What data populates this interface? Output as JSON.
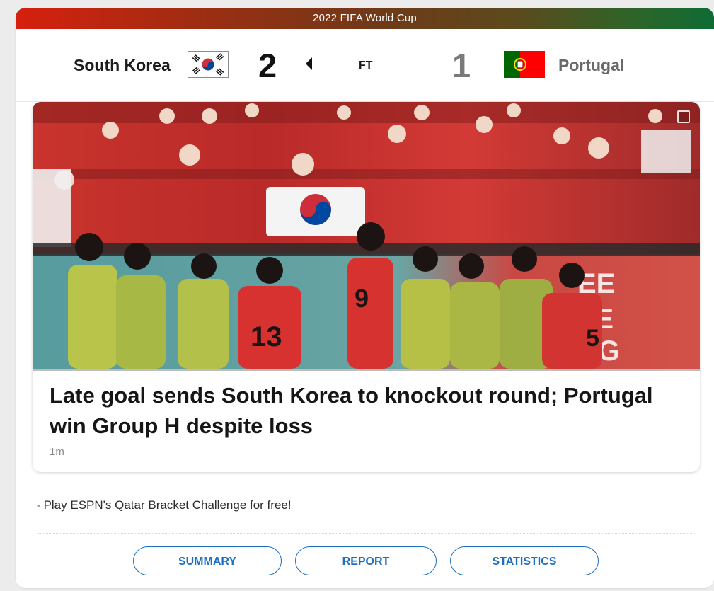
{
  "banner": {
    "title": "2022 FIFA World Cup"
  },
  "scoreboard": {
    "home": {
      "name": "South Korea",
      "score": "2",
      "flag_icon": "south-korea-flag"
    },
    "away": {
      "name": "Portugal",
      "score": "1",
      "flag_icon": "portugal-flag"
    },
    "status": "FT",
    "winner_indicator_icon": "left-triangle-icon"
  },
  "story": {
    "headline": "Late goal sends South Korea to knockout round; Portugal win Group H despite loss",
    "timestamp": "1m",
    "photo_icon": "photo-gallery-icon"
  },
  "promo": {
    "bullet": "•",
    "text": "Play ESPN's Qatar Bracket Challenge for free!"
  },
  "buttons": {
    "summary": "SUMMARY",
    "report": "REPORT",
    "statistics": "STATISTICS"
  },
  "colors": {
    "banner_start": "#d6200e",
    "banner_end": "#0f6c34",
    "link_blue": "#1d6fc0",
    "home_score": "#111111",
    "away_score": "#7a7a7a",
    "korea_red": "#cd2e3a",
    "korea_blue": "#0047a0",
    "portugal_green": "#006600",
    "portugal_red": "#ff0000"
  }
}
